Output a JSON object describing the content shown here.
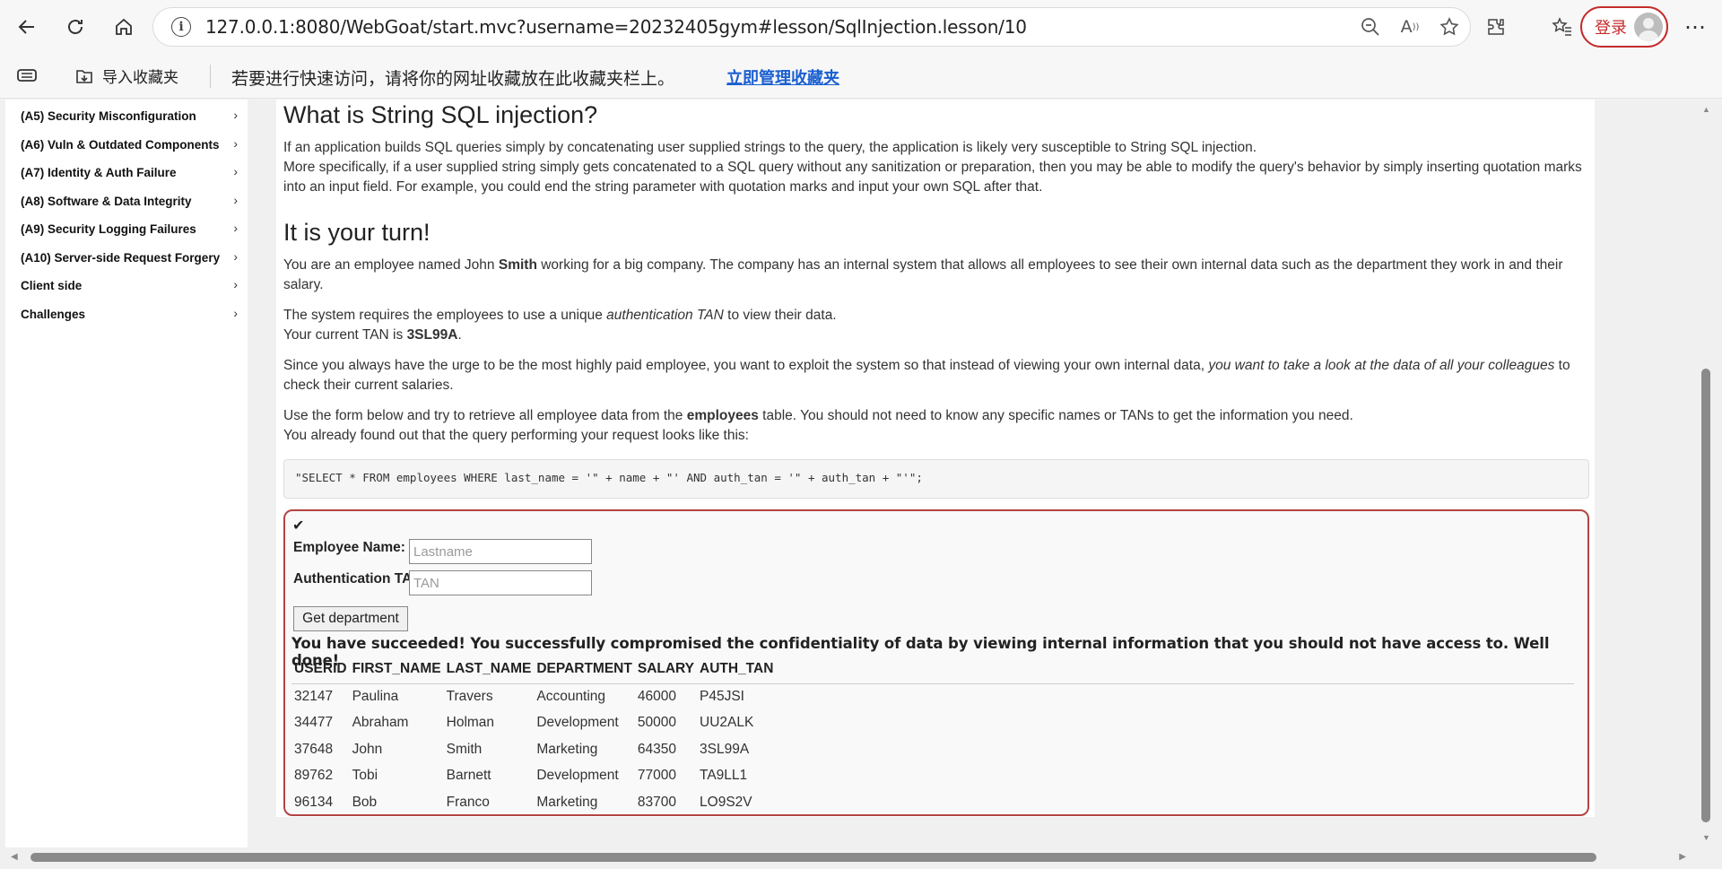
{
  "browser": {
    "url": "127.0.0.1:8080/WebGoat/start.mvc?username=20232405gym#lesson/SqlInjection.lesson/10",
    "login_label": "登录",
    "bookmarks": {
      "import_label": "导入收藏夹",
      "message": "若要进行快速访问，请将你的网址收藏放在此收藏夹栏上。",
      "manage_link": "立即管理收藏夹"
    }
  },
  "sidebar": {
    "items": [
      {
        "label": "(A5) Security Misconfiguration"
      },
      {
        "label": "(A6) Vuln & Outdated Components"
      },
      {
        "label": "(A7) Identity & Auth Failure"
      },
      {
        "label": "(A8) Software & Data Integrity"
      },
      {
        "label": "(A9) Security Logging Failures"
      },
      {
        "label": "(A10) Server-side Request Forgery"
      },
      {
        "label": "Client side"
      },
      {
        "label": "Challenges"
      }
    ]
  },
  "lesson": {
    "heading1": "What is String SQL injection?",
    "p1": "If an application builds SQL queries simply by concatenating user supplied strings to the query, the application is likely very susceptible to String SQL injection.",
    "p2": "More specifically, if a user supplied string simply gets concatenated to a SQL query without any sanitization or preparation, then you may be able to modify the query's behavior by simply inserting quotation marks into an input field. For example, you could end the string parameter with quotation marks and input your own SQL after that.",
    "heading2": "It is your turn!",
    "p3_a": "You are an employee named John ",
    "p3_b": "Smith",
    "p3_c": " working for a big company. The company has an internal system that allows all employees to see their own internal data such as the department they work in and their salary.",
    "p4_a": "The system requires the employees to use a unique ",
    "p4_b": "authentication TAN",
    "p4_c": " to view their data.",
    "p5_a": "Your current TAN is ",
    "p5_b": "3SL99A",
    "p5_c": ".",
    "p6_a": "Since you always have the urge to be the most highly paid employee, you want to exploit the system so that instead of viewing your own internal data, ",
    "p6_b": "you want to take a look at the data of all your colleagues",
    "p6_c": " to check their current salaries.",
    "p7_a": "Use the form below and try to retrieve all employee data from the ",
    "p7_b": "employees",
    "p7_c": " table. You should not need to know any specific names or TANs to get the information you need.",
    "p8": "You already found out that the query performing your request looks like this:",
    "query": "\"SELECT * FROM employees WHERE last_name = '\" + name + \"' AND auth_tan = '\" + auth_tan + \"'\";"
  },
  "form": {
    "check": "✔",
    "name_label": "Employee Name:",
    "name_placeholder": "Lastname",
    "tan_label": "Authentication TAN:",
    "tan_placeholder": "TAN",
    "submit_label": "Get department",
    "success": "You have succeeded! You successfully compromised the confidentiality of data by viewing internal information that you should not have access to. Well done!"
  },
  "results": {
    "headers": [
      "USERID",
      "FIRST_NAME",
      "LAST_NAME",
      "DEPARTMENT",
      "SALARY",
      "AUTH_TAN"
    ],
    "rows": [
      [
        "32147",
        "Paulina",
        "Travers",
        "Accounting",
        "46000",
        "P45JSI"
      ],
      [
        "34477",
        "Abraham",
        "Holman",
        "Development",
        "50000",
        "UU2ALK"
      ],
      [
        "37648",
        "John",
        "Smith",
        "Marketing",
        "64350",
        "3SL99A"
      ],
      [
        "89762",
        "Tobi",
        "Barnett",
        "Development",
        "77000",
        "TA9LL1"
      ],
      [
        "96134",
        "Bob",
        "Franco",
        "Marketing",
        "83700",
        "LO9S2V"
      ]
    ]
  }
}
